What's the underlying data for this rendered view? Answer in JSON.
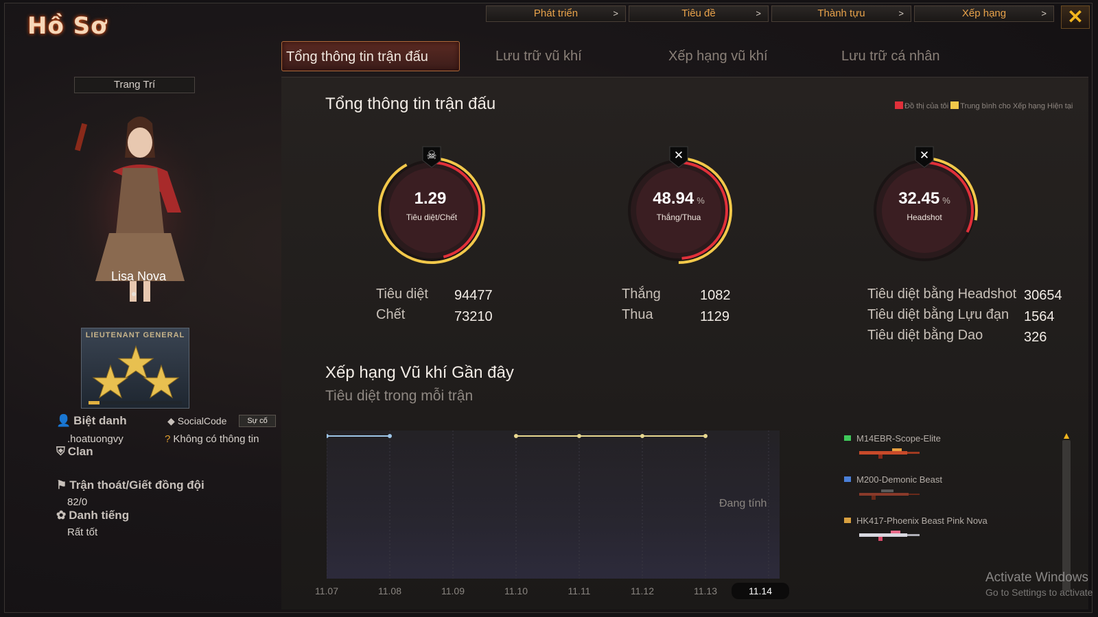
{
  "window": {
    "title": "Hồ Sơ",
    "close_label": "✕"
  },
  "top_nav": [
    {
      "label": "Phát triển"
    },
    {
      "label": "Tiêu đề"
    },
    {
      "label": "Thành tựu"
    },
    {
      "label": "Xếp hạng"
    }
  ],
  "top_nav_arrow": ">",
  "tabs": [
    {
      "label": "Tổng thông tin trận đấu",
      "active": true
    },
    {
      "label": "Lưu trữ vũ khí"
    },
    {
      "label": "Xếp hạng vũ khí"
    },
    {
      "label": "Lưu trữ cá nhân"
    }
  ],
  "profile": {
    "decorate_button": "Trang Trí",
    "character_name": "Lisa Nova",
    "rank_name": "LIEUTENANT GENERAL",
    "rank_progress": 0.12,
    "nickname_label": "Biệt danh",
    "nickname_value": ".hoatuongvy",
    "socialcode_label": "SocialCode",
    "socialcode_button": "Sự cố",
    "socialcode_value": "Không có thông tin",
    "clan_label": "Clan",
    "escape_label": "Trận thoát/Giết đồng đội",
    "escape_value": "82/0",
    "reputation_label": "Danh tiếng",
    "reputation_value": "Rất tốt"
  },
  "summary": {
    "title": "Tổng thông tin trận đấu",
    "legend_mine": "Đồ thị của tôi",
    "legend_avg": "Trung bình cho Xếp hạng Hiện tại",
    "colors": {
      "mine": "#e0303a",
      "avg": "#f2c84a"
    },
    "gauges": [
      {
        "value": "1.29",
        "unit": "",
        "label": "Tiêu diệt/Chết",
        "icon": "skull-icon",
        "glyph": "☠",
        "mine": 0.46,
        "avg": 0.92
      },
      {
        "value": "48.94",
        "unit": "%",
        "label": "Thắng/Thua",
        "icon": "crossed-guns-icon",
        "glyph": "✕",
        "mine": 0.4894,
        "avg": 0.5
      },
      {
        "value": "32.45",
        "unit": "%",
        "label": "Headshot",
        "icon": "headshot-icon",
        "glyph": "✕",
        "mine": 0.3245,
        "avg": 0.28
      }
    ],
    "kd_stats": [
      {
        "label": "Tiêu diệt",
        "value": "94477"
      },
      {
        "label": "Chết",
        "value": "73210"
      }
    ],
    "wl_stats": [
      {
        "label": "Thắng",
        "value": "1082"
      },
      {
        "label": "Thua",
        "value": "1129"
      }
    ],
    "hs_stats": [
      {
        "label": "Tiêu diệt bằng Headshot",
        "value": "30654"
      },
      {
        "label": "Tiêu diệt bằng Lựu đạn",
        "value": "1564"
      },
      {
        "label": "Tiêu diệt bằng Dao",
        "value": "326"
      }
    ]
  },
  "weapons_rank": {
    "title": "Xếp hạng Vũ khí Gần đây",
    "subtitle": "Tiêu diệt trong mỗi trận",
    "status": "Đang tính",
    "weapons": [
      {
        "name": "M14EBR-Scope-Elite",
        "color": "#3fc85a"
      },
      {
        "name": "M200-Demonic Beast",
        "color": "#4a7fd8"
      },
      {
        "name": "HK417-Phoenix Beast Pink Nova",
        "color": "#d8a040"
      }
    ]
  },
  "chart_data": {
    "type": "line",
    "title": "Xếp hạng Vũ khí Gần đây",
    "xlabel": "",
    "ylabel": "",
    "x": [
      "11.07",
      "11.08",
      "11.09",
      "11.10",
      "11.11",
      "11.12",
      "11.13",
      "11.14"
    ],
    "selected_x": "11.14",
    "series": [
      {
        "segment": "11.07-11.08",
        "values": [
          0,
          0,
          null,
          null,
          null,
          null,
          null,
          null
        ],
        "color": "#9ec6e8"
      },
      {
        "segment": "11.10-11.13",
        "values": [
          null,
          null,
          null,
          0,
          0,
          0,
          0,
          null
        ],
        "color": "#e8d890"
      }
    ],
    "ylim": [
      0,
      10
    ],
    "grid": false
  },
  "watermark": {
    "line1": "Activate Windows",
    "line2": "Go to Settings to activate"
  }
}
